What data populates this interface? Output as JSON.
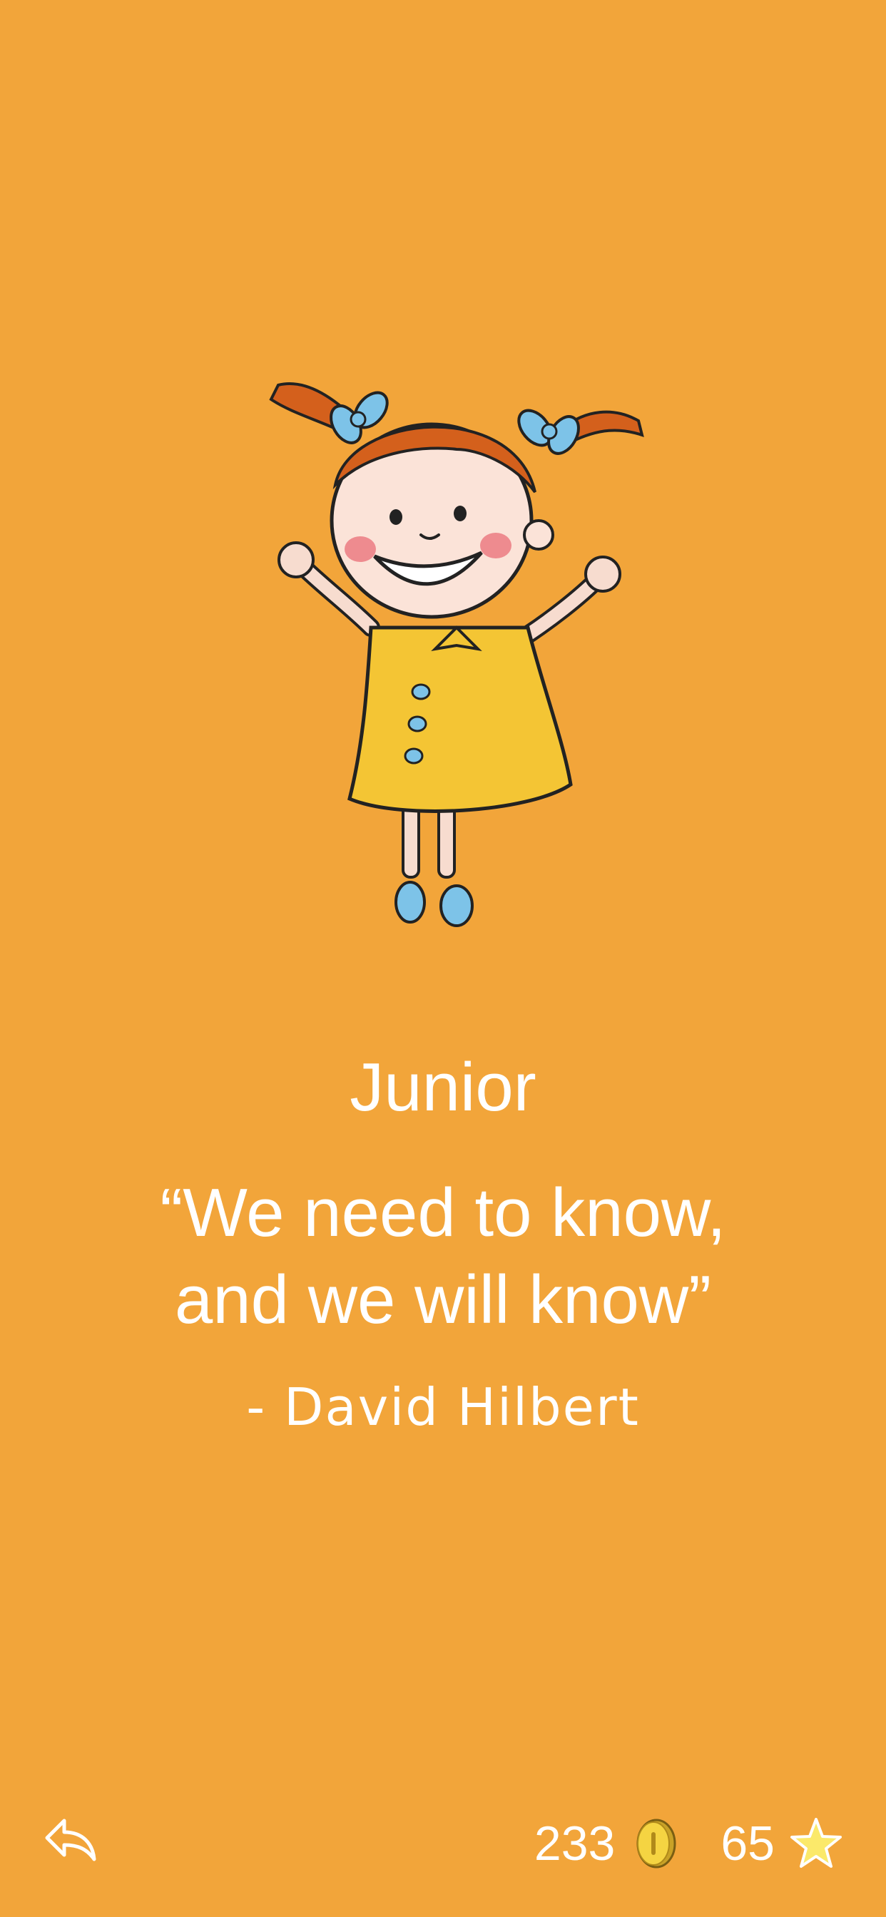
{
  "level": {
    "title": "Junior"
  },
  "quote": {
    "line1": "“We need to know,",
    "line2": "and we will know”",
    "author": "- David Hilbert"
  },
  "footer": {
    "coins": "233",
    "stars": "65",
    "back_icon": "reply-arrow-icon",
    "coin_icon": "gold-coin-icon",
    "star_icon": "yellow-star-icon"
  },
  "colors": {
    "background": "#F2A53A",
    "text": "#FFFFFF",
    "dress": "#F4C534",
    "hair": "#D4601C",
    "bow": "#7DC3E8"
  }
}
